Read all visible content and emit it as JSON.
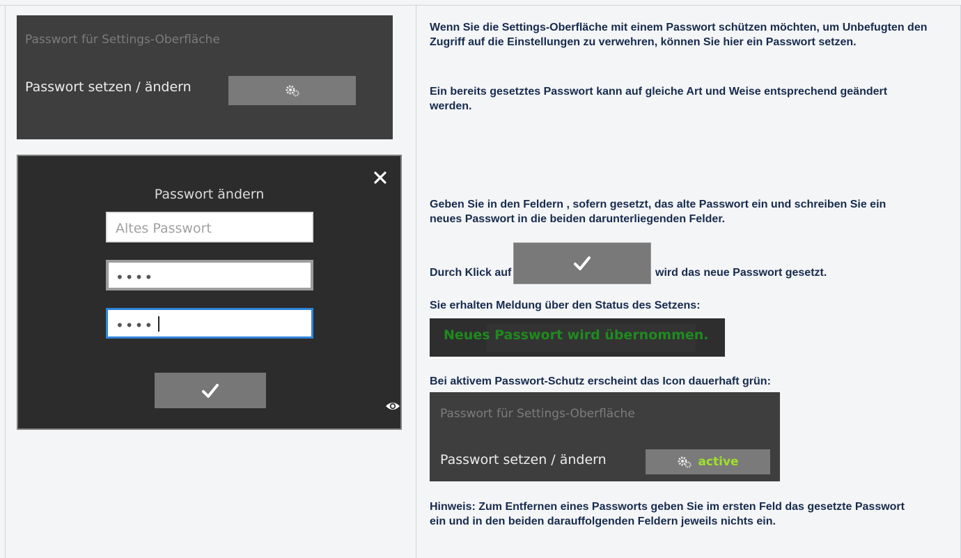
{
  "left": {
    "settings_panel": {
      "title": "Passwort für Settings-Oberfläche",
      "label": "Passwort setzen / ändern",
      "button_icon": "gears-icon"
    },
    "dialog": {
      "title": "Passwort ändern",
      "close_icon": "close-icon",
      "old_password_placeholder": "Altes Passwort",
      "new_password_value": "••••",
      "confirm_password_value": "••••",
      "submit_icon": "checkmark-icon",
      "eye_icon": "eye-icon"
    }
  },
  "right": {
    "intro_text": "Wenn Sie die Settings-Oberfläche mit einem Passwort schützen möchten, um Unbefugten den Zugriff auf die Einstellungen zu verwehren, können Sie hier ein Passwort setzen.",
    "change_text": "Ein bereits gesetztes Passwort kann auf gleiche Art und Weise entsprechend geändert werden.",
    "fields_text": "Geben Sie in den Feldern , sofern gesetzt, das alte Passwort ein und schreiben Sie ein neues Passwort in die beiden darunterliegenden Felder.",
    "click_prefix": "Durch Klick auf",
    "click_suffix": "wird das neue Passwort gesetzt.",
    "status_intro": "Sie erhalten Meldung über den Status des Setzens:",
    "status_message": "Neues Passwort wird übernommen.",
    "active_intro": "Bei aktivem Passwort-Schutz erscheint das Icon dauerhaft grün:",
    "active_panel": {
      "title": "Passwort für Settings-Oberfläche",
      "label": "Passwort setzen / ändern",
      "badge": "active"
    },
    "hint_text": "Hinweis: Zum Entfernen eines Passworts geben Sie im ersten Feld das gesetzte Passwort ein und in den beiden darauffolgenden Feldern jeweils nichts ein."
  },
  "colors": {
    "panel_bg": "#3e3e3e",
    "dialog_bg": "#2c2c2c",
    "status_green": "#1f8a1f",
    "active_green": "#9fe02a",
    "focus_blue": "#2f86d8",
    "text": "#172b4d"
  }
}
